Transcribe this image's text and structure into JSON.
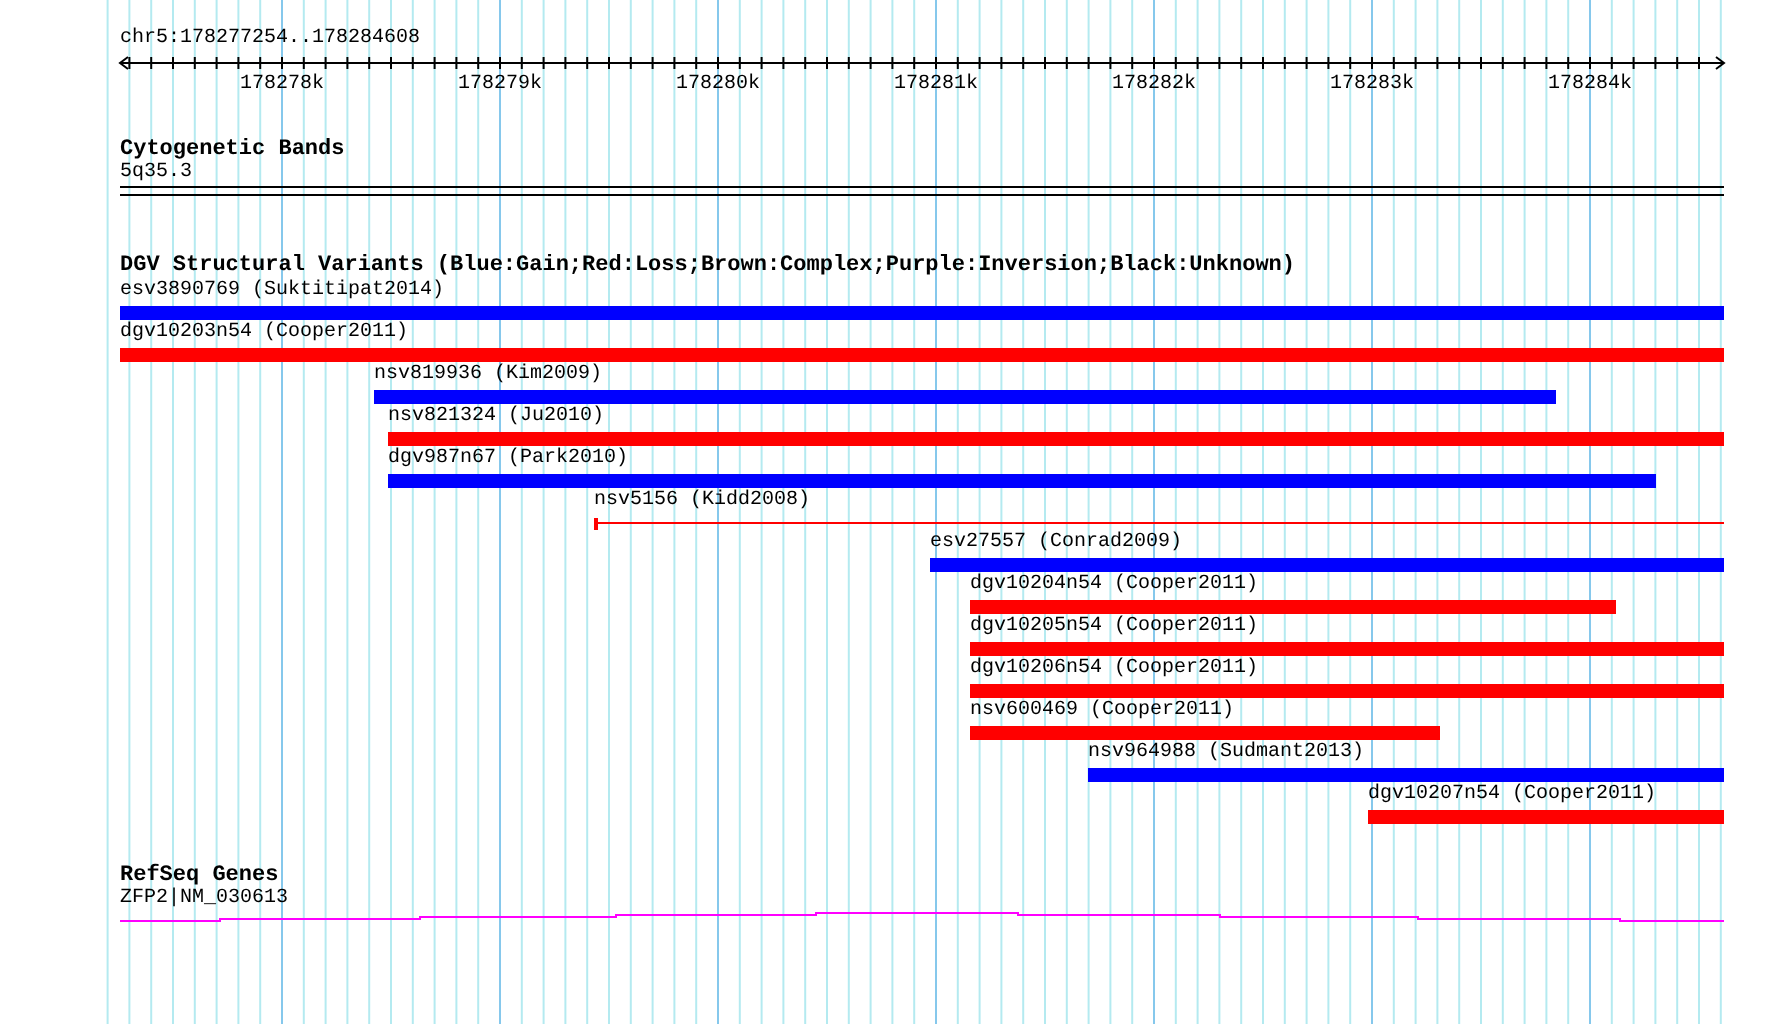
{
  "ruler": {
    "location": "chr5:178277254..178284608",
    "ticks": [
      "178278k",
      "178279k",
      "178280k",
      "178281k",
      "178282k",
      "178283k",
      "178284k"
    ]
  },
  "cytogenetic_bands": {
    "title": "Cytogenetic Bands",
    "band": "5q35.3"
  },
  "structural_variants": {
    "title": "DGV Structural Variants (Blue:Gain;Red:Loss;Brown:Complex;Purple:Inversion;Black:Unknown)",
    "features": [
      {
        "label": "esv3890769 (Suktitipat2014)",
        "color": "#0000ff",
        "kind": "bar"
      },
      {
        "label": "dgv10203n54 (Cooper2011)",
        "color": "#ff0000",
        "kind": "bar"
      },
      {
        "label": "nsv819936 (Kim2009)",
        "color": "#0000ff",
        "kind": "bar"
      },
      {
        "label": "nsv821324 (Ju2010)",
        "color": "#ff0000",
        "kind": "bar"
      },
      {
        "label": "dgv987n67 (Park2010)",
        "color": "#0000ff",
        "kind": "bar"
      },
      {
        "label": "nsv5156 (Kidd2008)",
        "color": "#ff0000",
        "kind": "line"
      },
      {
        "label": "esv27557 (Conrad2009)",
        "color": "#0000ff",
        "kind": "bar"
      },
      {
        "label": "dgv10204n54 (Cooper2011)",
        "color": "#ff0000",
        "kind": "bar"
      },
      {
        "label": "dgv10205n54 (Cooper2011)",
        "color": "#ff0000",
        "kind": "bar"
      },
      {
        "label": "dgv10206n54 (Cooper2011)",
        "color": "#ff0000",
        "kind": "bar"
      },
      {
        "label": "nsv600469 (Cooper2011)",
        "color": "#ff0000",
        "kind": "bar"
      },
      {
        "label": "nsv964988 (Sudmant2013)",
        "color": "#0000ff",
        "kind": "bar"
      },
      {
        "label": "dgv10207n54 (Cooper2011)",
        "color": "#ff0000",
        "kind": "bar"
      }
    ]
  },
  "refseq_genes": {
    "title": "RefSeq Genes",
    "gene": "ZFP2|NM_030613"
  }
}
